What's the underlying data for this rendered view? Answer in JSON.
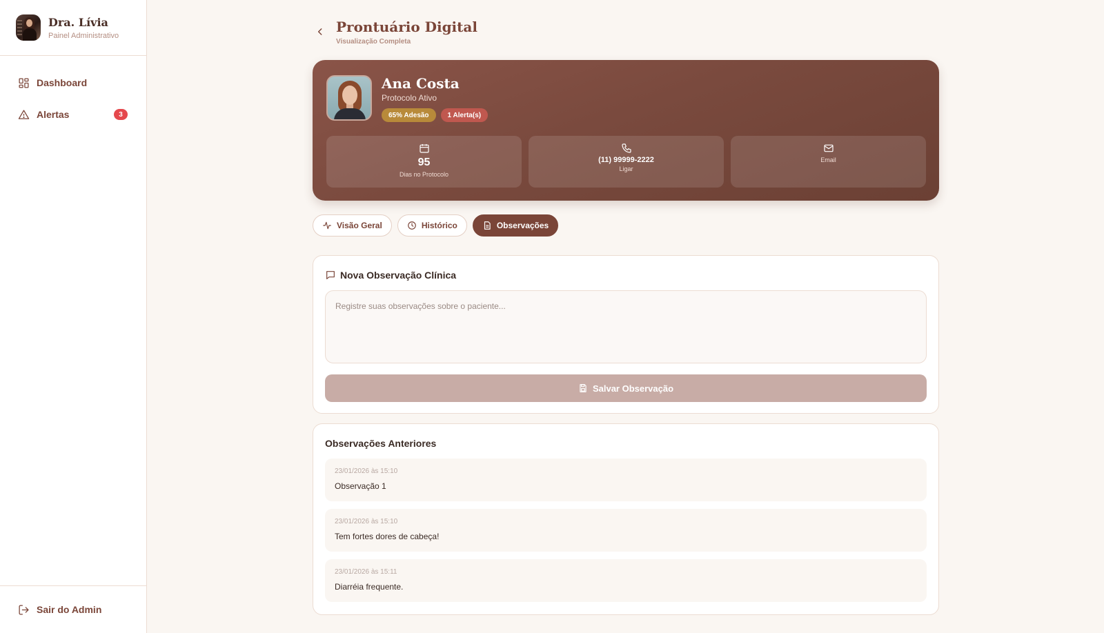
{
  "sidebar": {
    "title": "Dra. Lívia",
    "subtitle": "Painel Administrativo",
    "items": [
      {
        "label": "Dashboard",
        "icon": "dashboard-icon"
      },
      {
        "label": "Alertas",
        "icon": "alert-triangle-icon",
        "badge": "3"
      }
    ],
    "logout_label": "Sair do Admin"
  },
  "header": {
    "title": "Prontuário Digital",
    "subtitle": "Visualização Completa"
  },
  "patient": {
    "name": "Ana Costa",
    "status": "Protocolo Ativo",
    "adherence_badge": "65% Adesão",
    "alerts_badge": "1 Alerta(s)",
    "stats": {
      "days_value": "95",
      "days_label": "Dias no Protocolo",
      "phone": "(11) 99999-2222",
      "phone_label": "Ligar",
      "email_label": "Email"
    }
  },
  "tabs": [
    {
      "label": "Visão Geral",
      "icon": "activity-icon",
      "active": false
    },
    {
      "label": "Histórico",
      "icon": "clock-icon",
      "active": false
    },
    {
      "label": "Observações",
      "icon": "document-icon",
      "active": true
    }
  ],
  "new_note": {
    "title": "Nova Observação Clínica",
    "value": "",
    "placeholder": "Registre suas observações sobre o paciente...",
    "save_label": "Salvar Observação"
  },
  "previous_notes": {
    "title": "Observações Anteriores",
    "items": [
      {
        "date": "23/01/2026 às 15:10",
        "text": "Observação 1"
      },
      {
        "date": "23/01/2026 às 15:10",
        "text": "Tem fortes dores de cabeça!"
      },
      {
        "date": "23/01/2026 às 15:11",
        "text": "Diarréia frequente."
      }
    ]
  },
  "colors": {
    "brand": "#7a4538",
    "hero": "#7a4a3e",
    "badge_red": "#e5484d",
    "adherence": "#b88a3a",
    "save_disabled": "#c8aca6"
  }
}
